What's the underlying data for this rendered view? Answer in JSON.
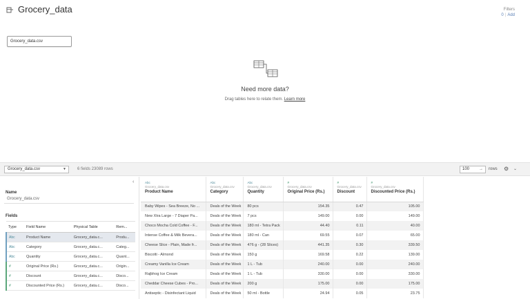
{
  "header": {
    "title": "Grocery_data",
    "filters_label": "Filters",
    "filters_count": "0",
    "filters_add": "Add"
  },
  "canvas": {
    "table_chip": "Grocery_data.csv",
    "need_title": "Need more data?",
    "need_sub": "Drag tables here to relate them.",
    "need_link": "Learn more"
  },
  "toolbar": {
    "table_select": "Grocery_data.csv",
    "meta": "6 fields 23089 rows",
    "rows_value": "100",
    "rows_label": "rows"
  },
  "left_panel": {
    "name_label": "Name",
    "name_value": "Grocery_data.csv",
    "fields_label": "Fields",
    "columns": [
      "Type",
      "Field Name",
      "Physical Table",
      "Rem..."
    ],
    "rows": [
      {
        "type": "Abc",
        "type_kind": "str",
        "field": "Product Name",
        "table": "Grocery_data.c...",
        "remote": "Produ...",
        "selected": true
      },
      {
        "type": "Abc",
        "type_kind": "str",
        "field": "Category",
        "table": "Grocery_data.c...",
        "remote": "Categ...",
        "selected": false
      },
      {
        "type": "Abc",
        "type_kind": "str",
        "field": "Quantity",
        "table": "Grocery_data.c...",
        "remote": "Quant...",
        "selected": false
      },
      {
        "type": "#",
        "type_kind": "num",
        "field": "Original Price (Rs.)",
        "table": "Grocery_data.c...",
        "remote": "Origin...",
        "selected": false
      },
      {
        "type": "#",
        "type_kind": "num",
        "field": "Discount",
        "table": "Grocery_data.c...",
        "remote": "Disco...",
        "selected": false
      },
      {
        "type": "#",
        "type_kind": "num",
        "field": "Discounted Price (Rs.)",
        "table": "Grocery_data.c...",
        "remote": "Disco...",
        "selected": false
      }
    ]
  },
  "grid": {
    "columns": [
      {
        "type": "Abc",
        "type_kind": "str",
        "source": "Grocery_data.csv",
        "name": "Product Name"
      },
      {
        "type": "Abc",
        "type_kind": "str",
        "source": "Grocery_data.csv",
        "name": "Category"
      },
      {
        "type": "Abc",
        "type_kind": "str",
        "source": "Grocery_data.csv",
        "name": "Quantity"
      },
      {
        "type": "#",
        "type_kind": "num",
        "source": "Grocery_data.csv",
        "name": "Original Price (Rs.)"
      },
      {
        "type": "#",
        "type_kind": "num",
        "source": "Grocery_data.csv",
        "name": "Discount"
      },
      {
        "type": "#",
        "type_kind": "num",
        "source": "Grocery_data.csv",
        "name": "Discounted Price (Rs.)"
      }
    ],
    "rows": [
      [
        "Baby Wipes - Sea Breeze, No ...",
        "Deals of the Week",
        "80 pcs",
        "154.35",
        "0.47",
        "105.00"
      ],
      [
        "New Xtra Large - 7 Diaper Pa...",
        "Deals of the Week",
        "7 pcs",
        "149.00",
        "0.00",
        "149.00"
      ],
      [
        "Choco Mocha Cold Coffee - F...",
        "Deals of the Week",
        "180 ml - Tetra Pack",
        "44.40",
        "0.11",
        "40.00"
      ],
      [
        "Intense Coffee & Milk Bevera...",
        "Deals of the Week",
        "180 ml - Can",
        "69.55",
        "0.07",
        "65.00"
      ],
      [
        "Cheese Slice - Plain, Made fr...",
        "Deals of the Week",
        "476 g - (28 Slices)",
        "441.35",
        "0.30",
        "339.50"
      ],
      [
        "Biscotti - Almond",
        "Deals of the Week",
        "150 g",
        "169.58",
        "0.22",
        "139.00"
      ],
      [
        "Creamy Vanilla Ice Cream",
        "Deals of the Week",
        "1 L - Tub",
        "240.00",
        "0.00",
        "240.00"
      ],
      [
        "Rajbhog Ice Cream",
        "Deals of the Week",
        "1 L - Tub",
        "330.00",
        "0.00",
        "330.00"
      ],
      [
        "Cheddar Cheese Cubes - Pro...",
        "Deals of the Week",
        "200 g",
        "175.00",
        "0.00",
        "175.00"
      ],
      [
        "Antiseptic - Disinfectant Liquid",
        "Deals of the Week",
        "50 ml - Bottle",
        "24.94",
        "0.05",
        "23.75"
      ]
    ]
  }
}
